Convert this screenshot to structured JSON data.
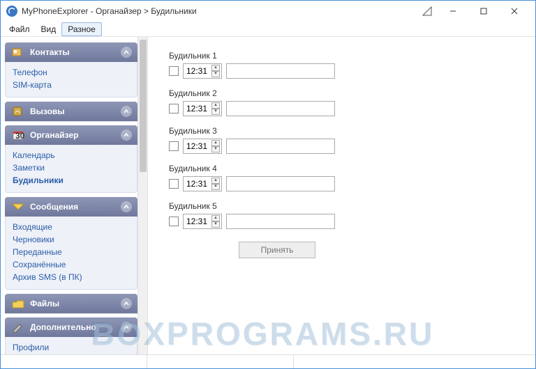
{
  "window": {
    "title": "MyPhoneExplorer -  Органайзер > Будильники"
  },
  "menubar": {
    "items": [
      "Файл",
      "Вид",
      "Разное"
    ],
    "activeIndex": 2
  },
  "sidebar": {
    "sections": [
      {
        "title": "Контакты",
        "items": [
          "Телефон",
          "SIM-карта"
        ]
      },
      {
        "title": "Вызовы",
        "items": []
      },
      {
        "title": "Органайзер",
        "items": [
          "Календарь",
          "Заметки",
          "Будильники"
        ],
        "boldIndex": 2
      },
      {
        "title": "Сообщения",
        "items": [
          "Входящие",
          "Черновики",
          "Переданные",
          "Сохранённые",
          "Архив SMS (в ПК)"
        ]
      },
      {
        "title": "Файлы",
        "items": []
      },
      {
        "title": "Дополнительно",
        "items": [
          "Профили"
        ]
      }
    ]
  },
  "alarms": {
    "rows": [
      {
        "label": "Будильник 1",
        "time": "12:31",
        "text": ""
      },
      {
        "label": "Будильник 2",
        "time": "12:31",
        "text": ""
      },
      {
        "label": "Будильник 3",
        "time": "12:31",
        "text": ""
      },
      {
        "label": "Будильник 4",
        "time": "12:31",
        "text": ""
      },
      {
        "label": "Будильник 5",
        "time": "12:31",
        "text": ""
      }
    ],
    "applyLabel": "Принять"
  },
  "watermark": "BOXPROGRAMS.RU"
}
